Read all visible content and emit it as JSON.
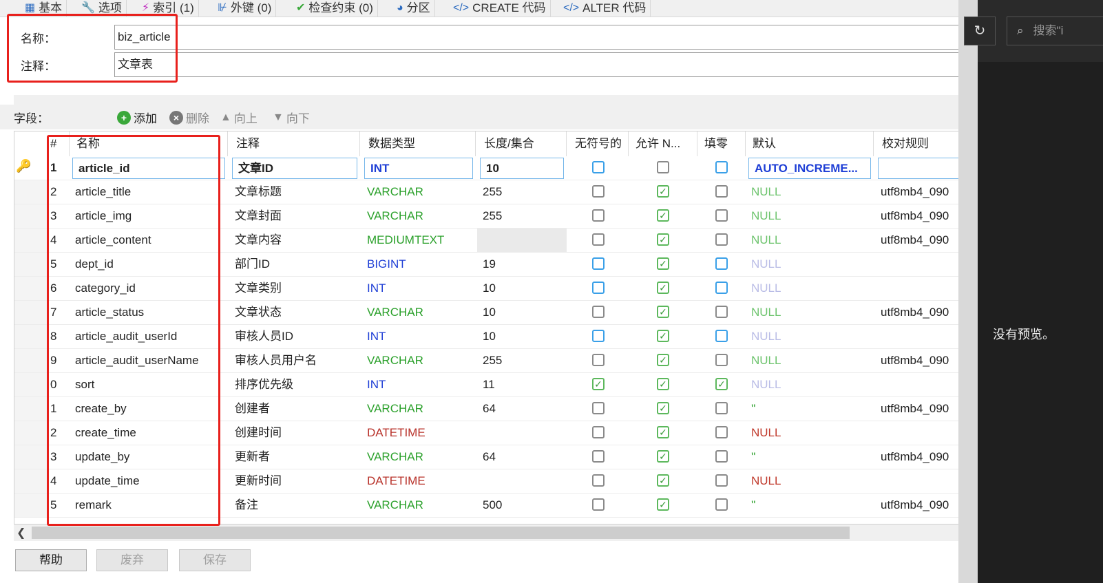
{
  "tabs": [
    {
      "label": "基本",
      "icon": "table-icon"
    },
    {
      "label": "选项",
      "icon": "wrench-icon"
    },
    {
      "label": "索引 (1)",
      "icon": "lightning-icon"
    },
    {
      "label": "外键 (0)",
      "icon": "foreign-key-icon"
    },
    {
      "label": "检查约束 (0)",
      "icon": "check-icon"
    },
    {
      "label": "分区",
      "icon": "pie-icon"
    },
    {
      "label": "CREATE 代码",
      "icon": "code-icon"
    },
    {
      "label": "ALTER 代码",
      "icon": "code-icon"
    }
  ],
  "general": {
    "name_label": "名称：",
    "name_value": "biz_article",
    "comment_label": "注释：",
    "comment_value": "文章表"
  },
  "fields_toolbar": {
    "label": "字段：",
    "add": "添加",
    "delete": "删除",
    "up": "向上",
    "down": "向下"
  },
  "grid": {
    "headers": [
      "#",
      "名称",
      "注释",
      "数据类型",
      "长度/集合",
      "无符号的",
      "允许 N...",
      "填零",
      "默认",
      "校对规则"
    ],
    "rows": [
      {
        "num": "1",
        "name": "article_id",
        "comment": "文章ID",
        "type": "INT",
        "length": "10",
        "unsigned": false,
        "nullable": false,
        "zerofill": false,
        "default": "AUTO_INCREME...",
        "collation": ""
      },
      {
        "num": "2",
        "name": "article_title",
        "comment": "文章标题",
        "type": "VARCHAR",
        "length": "255",
        "unsigned": false,
        "nullable": true,
        "zerofill": false,
        "default": "NULL",
        "collation": "utf8mb4_090"
      },
      {
        "num": "3",
        "name": "article_img",
        "comment": "文章封面",
        "type": "VARCHAR",
        "length": "255",
        "unsigned": false,
        "nullable": true,
        "zerofill": false,
        "default": "NULL",
        "collation": "utf8mb4_090"
      },
      {
        "num": "4",
        "name": "article_content",
        "comment": "文章内容",
        "type": "MEDIUMTEXT",
        "length": "",
        "unsigned": false,
        "nullable": true,
        "zerofill": false,
        "default": "NULL",
        "collation": "utf8mb4_090"
      },
      {
        "num": "5",
        "name": "dept_id",
        "comment": "部门ID",
        "type": "BIGINT",
        "length": "19",
        "unsigned": false,
        "nullable": true,
        "zerofill": false,
        "default": "NULL",
        "collation": ""
      },
      {
        "num": "6",
        "name": "category_id",
        "comment": "文章类别",
        "type": "INT",
        "length": "10",
        "unsigned": false,
        "nullable": true,
        "zerofill": false,
        "default": "NULL",
        "collation": ""
      },
      {
        "num": "7",
        "name": "article_status",
        "comment": "文章状态",
        "type": "VARCHAR",
        "length": "10",
        "unsigned": false,
        "nullable": true,
        "zerofill": false,
        "default": "NULL",
        "collation": "utf8mb4_090"
      },
      {
        "num": "8",
        "name": "article_audit_userId",
        "comment": "审核人员ID",
        "type": "INT",
        "length": "10",
        "unsigned": false,
        "nullable": true,
        "zerofill": false,
        "default": "NULL",
        "collation": ""
      },
      {
        "num": "9",
        "name": "article_audit_userName",
        "comment": "审核人员用户名",
        "type": "VARCHAR",
        "length": "255",
        "unsigned": false,
        "nullable": true,
        "zerofill": false,
        "default": "NULL",
        "collation": "utf8mb4_090"
      },
      {
        "num": "0",
        "name": "sort",
        "comment": "排序优先级",
        "type": "INT",
        "length": "11",
        "unsigned": true,
        "nullable": true,
        "zerofill": true,
        "default": "NULL",
        "collation": ""
      },
      {
        "num": "1",
        "name": "create_by",
        "comment": "创建者",
        "type": "VARCHAR",
        "length": "64",
        "unsigned": false,
        "nullable": true,
        "zerofill": false,
        "default": "''",
        "collation": "utf8mb4_090"
      },
      {
        "num": "2",
        "name": "create_time",
        "comment": "创建时间",
        "type": "DATETIME",
        "length": "",
        "unsigned": false,
        "nullable": true,
        "zerofill": false,
        "default": "NULL",
        "collation": ""
      },
      {
        "num": "3",
        "name": "update_by",
        "comment": "更新者",
        "type": "VARCHAR",
        "length": "64",
        "unsigned": false,
        "nullable": true,
        "zerofill": false,
        "default": "''",
        "collation": "utf8mb4_090"
      },
      {
        "num": "4",
        "name": "update_time",
        "comment": "更新时间",
        "type": "DATETIME",
        "length": "",
        "unsigned": false,
        "nullable": true,
        "zerofill": false,
        "default": "NULL",
        "collation": ""
      },
      {
        "num": "5",
        "name": "remark",
        "comment": "备注",
        "type": "VARCHAR",
        "length": "500",
        "unsigned": false,
        "nullable": true,
        "zerofill": false,
        "default": "''",
        "collation": "utf8mb4_090"
      }
    ]
  },
  "buttons": {
    "help": "帮助",
    "discard": "废弃",
    "save": "保存"
  },
  "right": {
    "search_placeholder": "搜索\"i",
    "no_preview": "没有预览。"
  },
  "colors": {
    "varchar": "#2aa02a",
    "int": "#1f3fd6",
    "datetime": "#b8322a",
    "null_green": "#6cc36c",
    "null_gray": "#b9bce6",
    "null_red": "#c0392b",
    "highlight": "#e8201c"
  }
}
